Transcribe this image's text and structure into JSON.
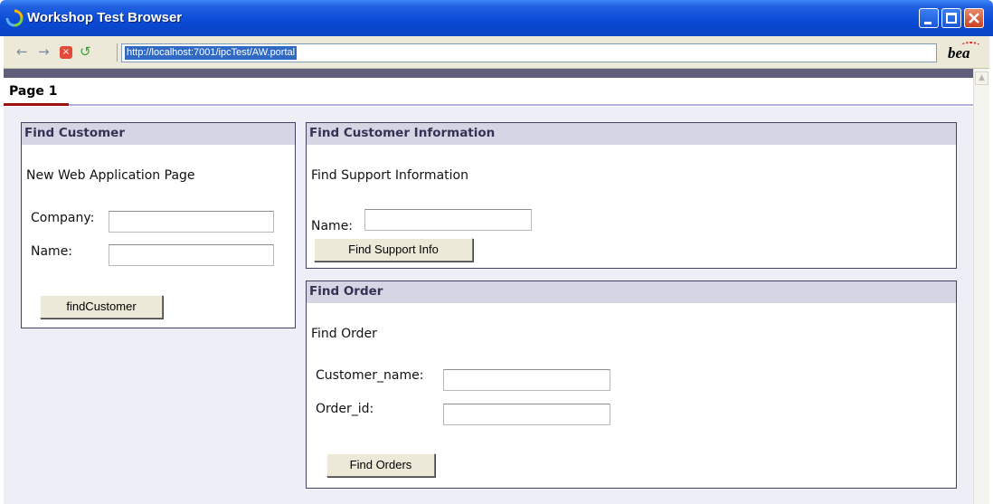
{
  "window": {
    "title": "Workshop Test Browser",
    "controls": {
      "minimize_icon": "minimize-icon",
      "maximize_icon": "maximize-icon",
      "close_icon": "close-icon"
    }
  },
  "toolbar": {
    "back_icon": "←",
    "forward_icon": "→",
    "stop_icon": "×",
    "refresh_icon": "↺",
    "address": "http://localhost:7001/ipcTest/AW.portal",
    "logo": "bea"
  },
  "page": {
    "tabs": [
      {
        "label": "Page 1",
        "active": true
      }
    ]
  },
  "portlets": {
    "find_customer": {
      "title": "Find Customer",
      "heading": "New Web Application Page",
      "company_label": "Company:",
      "company_value": "",
      "name_label": "Name:",
      "name_value": "",
      "button": "findCustomer"
    },
    "find_customer_info": {
      "title": "Find Customer Information",
      "heading": "Find Support Information",
      "name_label": "Name:",
      "name_value": "",
      "button": "Find Support Info"
    },
    "find_order": {
      "title": "Find Order",
      "heading": "Find Order",
      "customer_name_label": "Customer_name:",
      "customer_name_value": "",
      "order_id_label": "Order_id:",
      "order_id_value": "",
      "button": "Find Orders"
    }
  },
  "colors": {
    "titlebar": "#0a49d4",
    "portlet_header": "#d5d5e4",
    "portlet_border": "#414164",
    "content_bg": "#eeeef7",
    "active_tab": "#a01010"
  }
}
